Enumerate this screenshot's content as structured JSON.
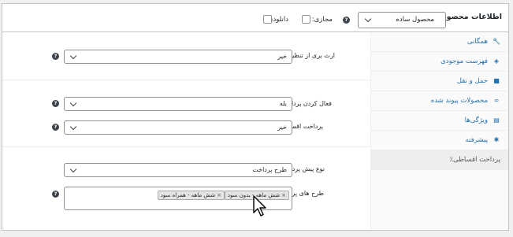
{
  "header": {
    "title": "اطلاعات محصول",
    "dash": "—",
    "product_type": "محصول ساده",
    "virtual_label": "مجازی:",
    "download_label": "دانلودی:"
  },
  "sidebar": {
    "items": [
      {
        "label": "همگانی",
        "icon": "wrench-icon",
        "glyph": "🔧"
      },
      {
        "label": "فهرست موجودی",
        "icon": "tag-icon",
        "glyph": "◈"
      },
      {
        "label": "حمل و نقل",
        "icon": "truck-icon",
        "glyph": "■"
      },
      {
        "label": "محصولات پیوند شده",
        "icon": "link-icon",
        "glyph": "∞"
      },
      {
        "label": "ویژگی‌ها",
        "icon": "list-icon",
        "glyph": "▤"
      },
      {
        "label": "پیشرفته",
        "icon": "gear-icon",
        "glyph": "✱"
      },
      {
        "label": "پرداخت اقساطی٪",
        "icon": "",
        "glyph": ""
      }
    ]
  },
  "fields": {
    "store_settings_label": "ارث بری از تنظیمات فروشگاه",
    "store_settings_value": "خیر",
    "enable_label": "فعال کردن پرداخت اقساطی",
    "enable_value": "بله",
    "mandatory_label": "پرداخت اقساطی اجباری",
    "mandatory_value": "خیر",
    "prepay_label": "نوع پیش پرداخت",
    "prepay_value": "طرح پرداخت",
    "plans_label": "طرح های پرداخت",
    "plans": [
      "شش ماهه - بدون سود",
      "شش ماهه - همراه سود"
    ]
  },
  "help_glyph": "?",
  "chip_remove": "×",
  "colors": {
    "link": "#2271b1",
    "border": "#c3c4c7",
    "bg": "#f0f0f1"
  }
}
